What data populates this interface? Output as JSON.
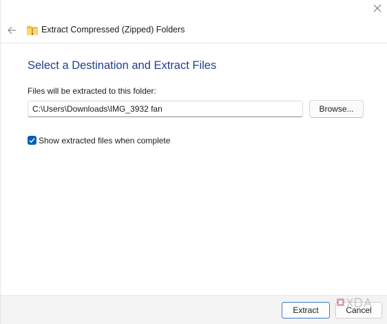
{
  "window": {
    "title": "Extract Compressed (Zipped) Folders"
  },
  "main": {
    "heading": "Select a Destination and Extract Files",
    "path_label": "Files will be extracted to this folder:",
    "path_value": "C:\\Users\\Downloads\\IMG_3932 fan",
    "browse_label": "Browse...",
    "checkbox_label": "Show extracted files when complete",
    "checkbox_checked": true
  },
  "footer": {
    "extract_label": "Extract",
    "cancel_label": "Cancel"
  },
  "watermark": {
    "text": "XDA"
  },
  "icons": {
    "close": "close-icon",
    "back": "arrow-left-icon",
    "folder": "zip-folder-icon",
    "check": "checkmark-icon"
  },
  "colors": {
    "heading": "#1f3f8f",
    "checkbox_accent": "#005fb8",
    "folder_yellow": "#f5c343",
    "default_button_border": "#3a79c4",
    "footer_bg": "#f3f3f3"
  }
}
